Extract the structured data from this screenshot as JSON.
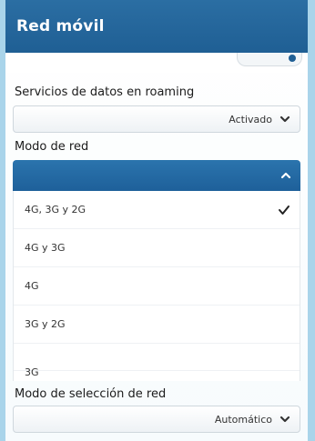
{
  "header": {
    "title": "Red móvil"
  },
  "sections": {
    "roaming": {
      "label": "Servicios de datos en roaming",
      "value": "Activado"
    },
    "network_mode": {
      "label": "Modo de red",
      "options": [
        {
          "label": "4G, 3G y 2G",
          "selected": true
        },
        {
          "label": "4G y 3G",
          "selected": false
        },
        {
          "label": "4G",
          "selected": false
        },
        {
          "label": "3G y 2G",
          "selected": false
        },
        {
          "label": "3G",
          "selected": false
        }
      ]
    },
    "network_selection": {
      "label": "Modo de selección de red",
      "value": "Automático"
    }
  },
  "colors": {
    "header": "#1f5f94",
    "accent": "#2b74ad",
    "background": "#ffffff"
  },
  "icons": {
    "chevron": "chevron-down-icon",
    "chevron_up": "chevron-up-icon",
    "check": "checkmark-icon"
  }
}
